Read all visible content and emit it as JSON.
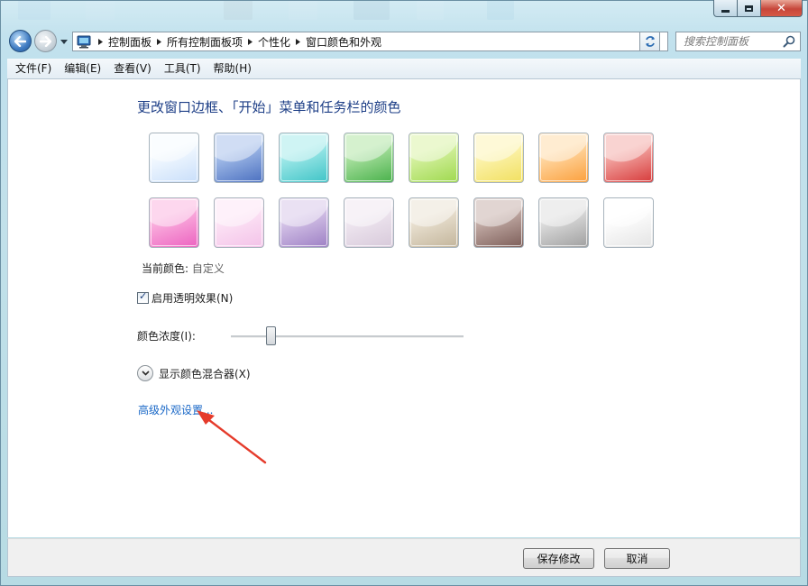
{
  "colors": {
    "accent": "#1e3f87",
    "link": "#1a68c7",
    "window_glass": "#c4e2ee",
    "close_button": "#c7463a"
  },
  "navigation": {
    "back_icon": "back-arrow-icon",
    "forward_icon": "forward-arrow-icon",
    "address_icon": "control-panel-icon",
    "breadcrumbs": [
      {
        "label": "控制面板"
      },
      {
        "label": "所有控制面板项"
      },
      {
        "label": "个性化"
      },
      {
        "label": "窗口颜色和外观"
      }
    ],
    "search_placeholder": "搜索控制面板"
  },
  "menu": [
    "文件(F)",
    "编辑(E)",
    "查看(V)",
    "工具(T)",
    "帮助(H)"
  ],
  "page": {
    "title": "更改窗口边框、「开始」菜单和任务栏的颜色",
    "swatches": [
      {
        "top": "#f6fbff",
        "bottom": "#c8defa"
      },
      {
        "top": "#a9c2ec",
        "bottom": "#4a6fbf"
      },
      {
        "top": "#a8ecec",
        "bottom": "#3fc3c6"
      },
      {
        "top": "#b2e5a7",
        "bottom": "#48b04a"
      },
      {
        "top": "#daf3a8",
        "bottom": "#9ed84e"
      },
      {
        "top": "#fdf5b6",
        "bottom": "#f1df5f"
      },
      {
        "top": "#ffdcab",
        "bottom": "#fb9f3c"
      },
      {
        "top": "#f5b0ac",
        "bottom": "#d63a3a"
      },
      {
        "top": "#fbb6e0",
        "bottom": "#ec62c0"
      },
      {
        "top": "#fde6f6",
        "bottom": "#f3c2e8"
      },
      {
        "top": "#d9c9ea",
        "bottom": "#9d7fc4"
      },
      {
        "top": "#f0e8f1",
        "bottom": "#d7c9da"
      },
      {
        "top": "#ece4d5",
        "bottom": "#c3b59b"
      },
      {
        "top": "#c9b3ad",
        "bottom": "#7c5d58"
      },
      {
        "top": "#e1e1e1",
        "bottom": "#9f9f9f"
      },
      {
        "top": "#ffffff",
        "bottom": "#e4e4e4"
      }
    ],
    "current_color_label": "当前颜色:",
    "current_color_value": "自定义",
    "transparency_label": "启用透明效果(N)",
    "transparency_checked": true,
    "intensity_label": "颜色浓度(I):",
    "intensity_fraction": 0.17,
    "mixer_label": "显示颜色混合器(X)",
    "advanced_link": "高级外观设置..."
  },
  "footer": {
    "save_label": "保存修改",
    "cancel_label": "取消"
  }
}
